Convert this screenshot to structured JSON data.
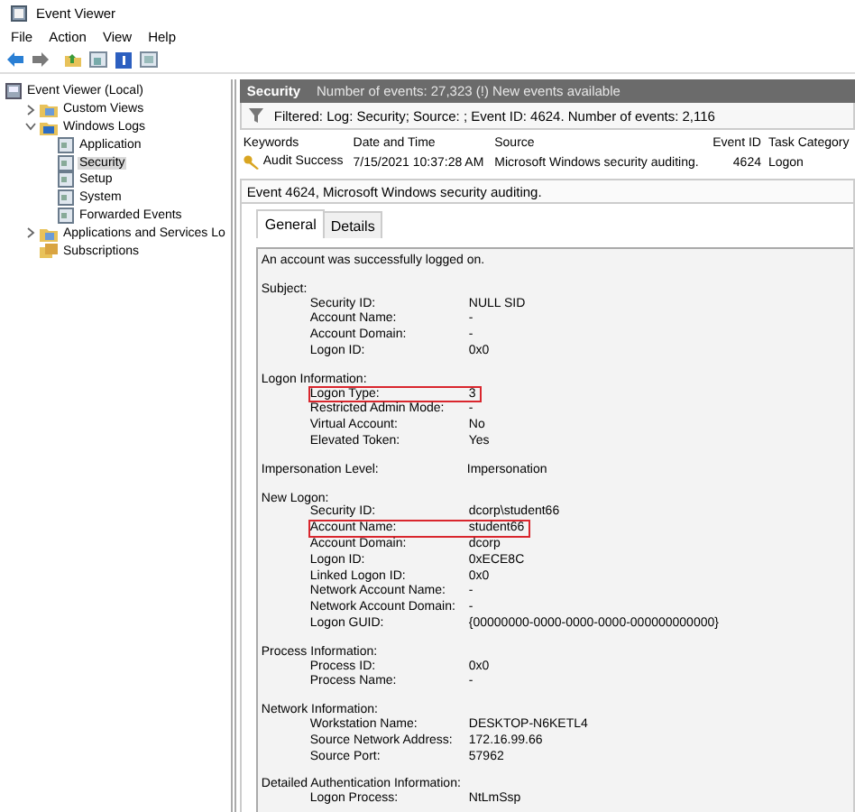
{
  "window": {
    "title": "Event Viewer"
  },
  "menu": [
    "File",
    "Action",
    "View",
    "Help"
  ],
  "tree": [
    {
      "label": "Event Viewer (Local)",
      "kind": "root",
      "selected": false,
      "children": [
        {
          "label": "Custom Views",
          "kind": "folder",
          "expanded": false,
          "selected": false
        },
        {
          "label": "Windows Logs",
          "kind": "logs",
          "expanded": true,
          "selected": false,
          "children": [
            {
              "label": "Application",
              "kind": "log",
              "selected": false
            },
            {
              "label": "Security",
              "kind": "log",
              "selected": true
            },
            {
              "label": "Setup",
              "kind": "log",
              "selected": false
            },
            {
              "label": "System",
              "kind": "log",
              "selected": false
            },
            {
              "label": "Forwarded Events",
              "kind": "log",
              "selected": false
            }
          ]
        },
        {
          "label": "Applications and Services Lo",
          "kind": "folder",
          "expanded": false,
          "selected": false
        },
        {
          "label": "Subscriptions",
          "kind": "subs",
          "selected": false
        }
      ]
    }
  ],
  "header": {
    "title": "Security",
    "info": "Number of events: 27,323 (!) New events available"
  },
  "filter": "Filtered: Log: Security; Source: ; Event ID: 4624. Number of events: 2,116",
  "table": {
    "columns": [
      "Keywords",
      "Date and Time",
      "Source",
      "Event ID",
      "Task Category"
    ],
    "rows": [
      {
        "cells": [
          "Audit Success",
          "7/15/2021 10:37:28 AM",
          "Microsoft Windows security auditing.",
          "4624",
          "Logon"
        ]
      }
    ]
  },
  "event": {
    "title": "Event 4624, Microsoft Windows security auditing.",
    "tabs": [
      {
        "label": "General",
        "selected": true
      },
      {
        "label": "Details",
        "selected": false
      }
    ],
    "summary": "An account was successfully logged on.",
    "sections": [
      {
        "kind": "group",
        "heading": "Subject:",
        "fields": [
          {
            "label": "Security ID:",
            "value": "NULL SID",
            "highlighted": false
          },
          {
            "label": "Account Name:",
            "value": "-",
            "highlighted": false
          },
          {
            "label": "Account Domain:",
            "value": "-",
            "highlighted": false
          },
          {
            "label": "Logon ID:",
            "value": "0x0",
            "highlighted": false
          }
        ]
      },
      {
        "kind": "group",
        "heading": "Logon Information:",
        "fields": [
          {
            "label": "Logon Type:",
            "value": "3",
            "highlighted": true
          },
          {
            "label": "Restricted Admin Mode:",
            "value": "-",
            "highlighted": false
          },
          {
            "label": "Virtual Account:",
            "value": "No",
            "highlighted": false
          },
          {
            "label": "Elevated Token:",
            "value": "Yes",
            "highlighted": false
          }
        ]
      },
      {
        "kind": "field",
        "heading": "Impersonation Level:",
        "value": "Impersonation"
      },
      {
        "kind": "group",
        "heading": "New Logon:",
        "fields": [
          {
            "label": "Security ID:",
            "value": "dcorp\\student66",
            "highlighted": false
          },
          {
            "label": "Account Name:",
            "value": "student66",
            "highlighted": true
          },
          {
            "label": "Account Domain:",
            "value": "dcorp",
            "highlighted": false
          },
          {
            "label": "Logon ID:",
            "value": "0xECE8C",
            "highlighted": false
          },
          {
            "label": "Linked Logon ID:",
            "value": "0x0",
            "highlighted": false
          },
          {
            "label": "Network Account Name:",
            "value": "-",
            "highlighted": false
          },
          {
            "label": "Network Account Domain:",
            "value": "-",
            "highlighted": false
          },
          {
            "label": "Logon GUID:",
            "value": "{00000000-0000-0000-0000-000000000000}",
            "highlighted": false
          }
        ]
      },
      {
        "kind": "group",
        "heading": "Process Information:",
        "fields": [
          {
            "label": "Process ID:",
            "value": "0x0",
            "highlighted": false
          },
          {
            "label": "Process Name:",
            "value": "-",
            "highlighted": false
          }
        ]
      },
      {
        "kind": "group",
        "heading": "Network Information:",
        "fields": [
          {
            "label": "Workstation Name:",
            "value": "DESKTOP-N6KETL4",
            "highlighted": false
          },
          {
            "label": "Source Network Address:",
            "value": "172.16.99.66",
            "highlighted": false
          },
          {
            "label": "Source Port:",
            "value": "57962",
            "highlighted": false
          }
        ]
      },
      {
        "kind": "group",
        "heading": "Detailed Authentication Information:",
        "fields": [
          {
            "label": "Logon Process:",
            "value": "NtLmSsp",
            "highlighted": false
          }
        ]
      }
    ]
  }
}
